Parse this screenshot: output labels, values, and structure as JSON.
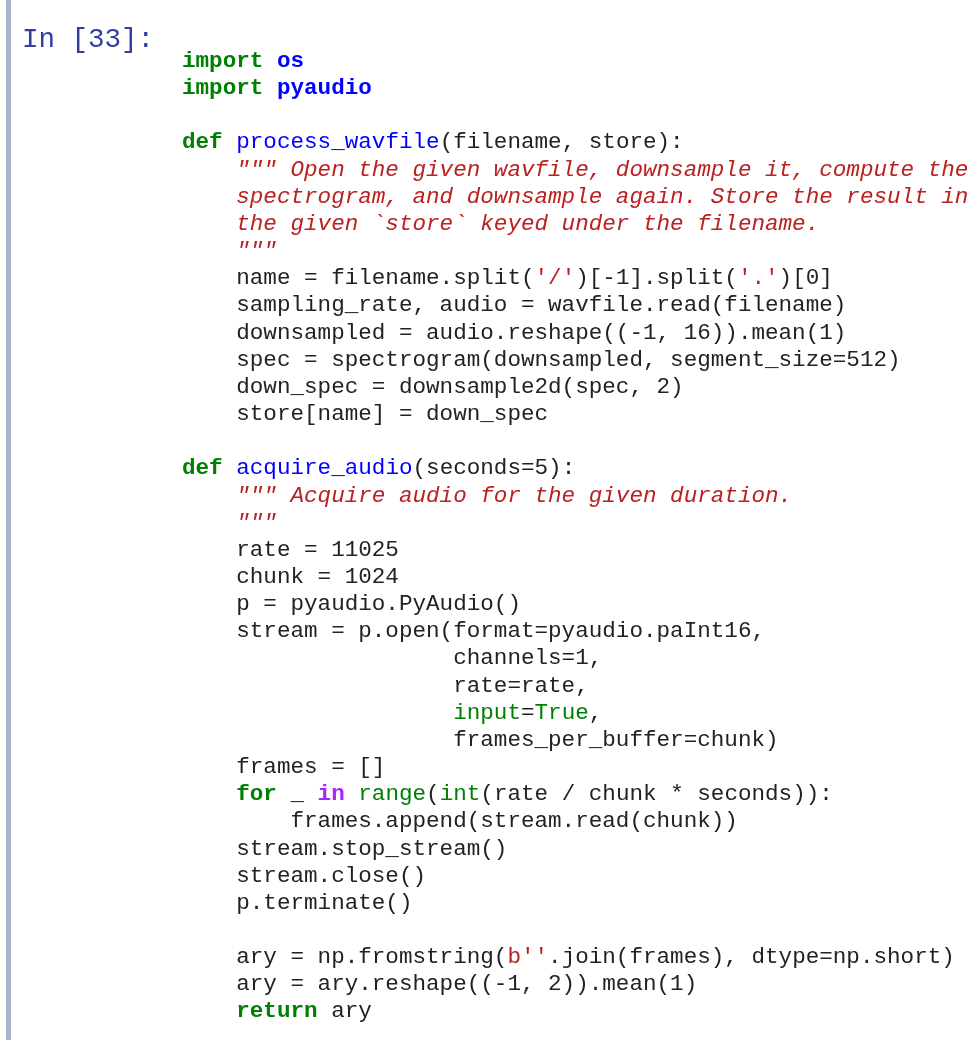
{
  "cell": {
    "prompt": "In [33]:",
    "lines": [
      {
        "kind": "code",
        "tokens": [
          {
            "kind": "kw",
            "text": "import"
          },
          {
            "kind": "mod",
            "text": " os"
          }
        ]
      },
      {
        "kind": "code",
        "tokens": [
          {
            "kind": "kw",
            "text": "import"
          },
          {
            "kind": "mod",
            "text": " pyaudio"
          }
        ]
      },
      {
        "kind": "blank"
      },
      {
        "kind": "code",
        "tokens": [
          {
            "kind": "kw",
            "text": "def"
          },
          {
            "kind": "fn",
            "text": " process_wavfile"
          },
          {
            "kind": "plain",
            "text": "(filename, store):"
          }
        ]
      },
      {
        "kind": "code",
        "tokens": [
          {
            "kind": "doc",
            "text": "    \"\"\" Open the given wavfile, downsample it, compute the"
          }
        ]
      },
      {
        "kind": "code",
        "tokens": [
          {
            "kind": "doc",
            "text": "    spectrogram, and downsample again. Store the result in"
          }
        ]
      },
      {
        "kind": "code",
        "tokens": [
          {
            "kind": "doc",
            "text": "    the given `store` keyed under the filename."
          }
        ]
      },
      {
        "kind": "code",
        "tokens": [
          {
            "kind": "doc",
            "text": "    \"\"\""
          }
        ]
      },
      {
        "kind": "code",
        "tokens": [
          {
            "kind": "plain",
            "text": "    name = filename.split("
          },
          {
            "kind": "str",
            "text": "'/'"
          },
          {
            "kind": "plain",
            "text": ")[-1].split("
          },
          {
            "kind": "str",
            "text": "'.'"
          },
          {
            "kind": "plain",
            "text": ")[0]"
          }
        ]
      },
      {
        "kind": "code",
        "tokens": [
          {
            "kind": "plain",
            "text": "    sampling_rate, audio = wavfile.read(filename)"
          }
        ]
      },
      {
        "kind": "code",
        "tokens": [
          {
            "kind": "plain",
            "text": "    downsampled = audio.reshape((-1, 16)).mean(1)"
          }
        ]
      },
      {
        "kind": "code",
        "tokens": [
          {
            "kind": "plain",
            "text": "    spec = spectrogram(downsampled, segment_size=512)"
          }
        ]
      },
      {
        "kind": "code",
        "tokens": [
          {
            "kind": "plain",
            "text": "    down_spec = downsample2d(spec, 2)"
          }
        ]
      },
      {
        "kind": "code",
        "tokens": [
          {
            "kind": "plain",
            "text": "    store[name] = down_spec"
          }
        ]
      },
      {
        "kind": "blank"
      },
      {
        "kind": "code",
        "tokens": [
          {
            "kind": "kw",
            "text": "def"
          },
          {
            "kind": "fn",
            "text": " acquire_audio"
          },
          {
            "kind": "plain",
            "text": "(seconds=5):"
          }
        ]
      },
      {
        "kind": "code",
        "tokens": [
          {
            "kind": "doc",
            "text": "    \"\"\" Acquire audio for the given duration."
          }
        ]
      },
      {
        "kind": "code",
        "tokens": [
          {
            "kind": "doc",
            "text": "    \"\"\""
          }
        ]
      },
      {
        "kind": "code",
        "tokens": [
          {
            "kind": "plain",
            "text": "    rate = 11025"
          }
        ]
      },
      {
        "kind": "code",
        "tokens": [
          {
            "kind": "plain",
            "text": "    chunk = 1024"
          }
        ]
      },
      {
        "kind": "code",
        "tokens": [
          {
            "kind": "plain",
            "text": "    p = pyaudio.PyAudio()"
          }
        ]
      },
      {
        "kind": "code",
        "tokens": [
          {
            "kind": "plain",
            "text": "    stream = p.open(format=pyaudio.paInt16,"
          }
        ]
      },
      {
        "kind": "code",
        "tokens": [
          {
            "kind": "plain",
            "text": "                    channels=1,"
          }
        ]
      },
      {
        "kind": "code",
        "tokens": [
          {
            "kind": "plain",
            "text": "                    rate=rate,"
          }
        ]
      },
      {
        "kind": "code",
        "tokens": [
          {
            "kind": "builtin",
            "text": "                    input"
          },
          {
            "kind": "plain",
            "text": "="
          },
          {
            "kind": "builtin",
            "text": "True"
          },
          {
            "kind": "plain",
            "text": ","
          }
        ]
      },
      {
        "kind": "code",
        "tokens": [
          {
            "kind": "plain",
            "text": "                    frames_per_buffer=chunk)"
          }
        ]
      },
      {
        "kind": "code",
        "tokens": [
          {
            "kind": "plain",
            "text": "    frames = []"
          }
        ]
      },
      {
        "kind": "code",
        "tokens": [
          {
            "kind": "kw",
            "text": "    for"
          },
          {
            "kind": "plain",
            "text": " _ "
          },
          {
            "kind": "op",
            "text": "in"
          },
          {
            "kind": "builtin",
            "text": " range"
          },
          {
            "kind": "plain",
            "text": "("
          },
          {
            "kind": "builtin",
            "text": "int"
          },
          {
            "kind": "plain",
            "text": "(rate / chunk * seconds)):"
          }
        ]
      },
      {
        "kind": "code",
        "tokens": [
          {
            "kind": "plain",
            "text": "        frames.append(stream.read(chunk))"
          }
        ]
      },
      {
        "kind": "code",
        "tokens": [
          {
            "kind": "plain",
            "text": "    stream.stop_stream()"
          }
        ]
      },
      {
        "kind": "code",
        "tokens": [
          {
            "kind": "plain",
            "text": "    stream.close()"
          }
        ]
      },
      {
        "kind": "code",
        "tokens": [
          {
            "kind": "plain",
            "text": "    p.terminate()"
          }
        ]
      },
      {
        "kind": "blank"
      },
      {
        "kind": "code",
        "tokens": [
          {
            "kind": "plain",
            "text": "    ary = np.fromstring("
          },
          {
            "kind": "str",
            "text": "b''"
          },
          {
            "kind": "plain",
            "text": ".join(frames), dtype=np.short)"
          }
        ]
      },
      {
        "kind": "code",
        "tokens": [
          {
            "kind": "plain",
            "text": "    ary = ary.reshape((-1, 2)).mean(1)"
          }
        ]
      },
      {
        "kind": "code",
        "tokens": [
          {
            "kind": "kw",
            "text": "    return"
          },
          {
            "kind": "plain",
            "text": " ary"
          }
        ]
      }
    ]
  }
}
